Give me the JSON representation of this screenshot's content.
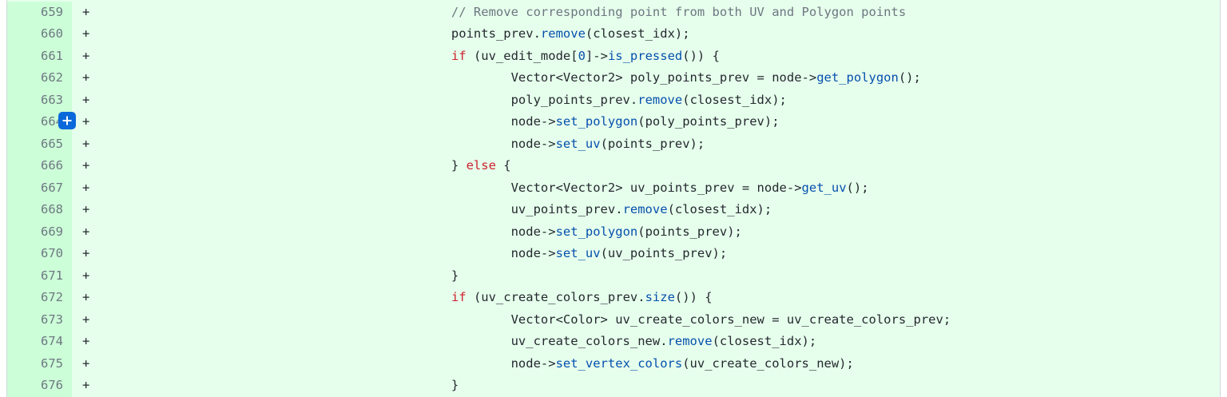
{
  "diff": {
    "marker": "+",
    "add_button_icon": "plus-icon",
    "colors": {
      "added_background": "#e6ffec",
      "added_gutter": "#ccffd8",
      "keyword": "#cf222e",
      "function": "#0550ae",
      "comment": "#6e7781",
      "button": "#0969da"
    },
    "lines": [
      {
        "num": "659",
        "tokens": [
          {
            "t": "cm",
            "s": "                                                // Remove corresponding point from both UV and Polygon points"
          }
        ]
      },
      {
        "num": "660",
        "tokens": [
          {
            "t": "pl",
            "s": "                                                points_prev."
          },
          {
            "t": "fn",
            "s": "remove"
          },
          {
            "t": "pl",
            "s": "(closest_idx);"
          }
        ]
      },
      {
        "num": "661",
        "tokens": [
          {
            "t": "pl",
            "s": "                                                "
          },
          {
            "t": "kw",
            "s": "if"
          },
          {
            "t": "pl",
            "s": " (uv_edit_mode["
          },
          {
            "t": "num",
            "s": "0"
          },
          {
            "t": "pl",
            "s": "]->"
          },
          {
            "t": "fn",
            "s": "is_pressed"
          },
          {
            "t": "pl",
            "s": "()) {"
          }
        ]
      },
      {
        "num": "662",
        "tokens": [
          {
            "t": "pl",
            "s": "                                                        Vector<Vector2> poly_points_prev = node->"
          },
          {
            "t": "fn",
            "s": "get_polygon"
          },
          {
            "t": "pl",
            "s": "();"
          }
        ]
      },
      {
        "num": "663",
        "tokens": [
          {
            "t": "pl",
            "s": "                                                        poly_points_prev."
          },
          {
            "t": "fn",
            "s": "remove"
          },
          {
            "t": "pl",
            "s": "(closest_idx);"
          }
        ]
      },
      {
        "num": "664",
        "tokens": [
          {
            "t": "pl",
            "s": "                                                        node->"
          },
          {
            "t": "fn",
            "s": "set_polygon"
          },
          {
            "t": "pl",
            "s": "(poly_points_prev);"
          }
        ]
      },
      {
        "num": "665",
        "tokens": [
          {
            "t": "pl",
            "s": "                                                        node->"
          },
          {
            "t": "fn",
            "s": "set_uv"
          },
          {
            "t": "pl",
            "s": "(points_prev);"
          }
        ]
      },
      {
        "num": "666",
        "tokens": [
          {
            "t": "pl",
            "s": "                                                } "
          },
          {
            "t": "kw",
            "s": "else"
          },
          {
            "t": "pl",
            "s": " {"
          }
        ]
      },
      {
        "num": "667",
        "tokens": [
          {
            "t": "pl",
            "s": "                                                        Vector<Vector2> uv_points_prev = node->"
          },
          {
            "t": "fn",
            "s": "get_uv"
          },
          {
            "t": "pl",
            "s": "();"
          }
        ]
      },
      {
        "num": "668",
        "tokens": [
          {
            "t": "pl",
            "s": "                                                        uv_points_prev."
          },
          {
            "t": "fn",
            "s": "remove"
          },
          {
            "t": "pl",
            "s": "(closest_idx);"
          }
        ]
      },
      {
        "num": "669",
        "tokens": [
          {
            "t": "pl",
            "s": "                                                        node->"
          },
          {
            "t": "fn",
            "s": "set_polygon"
          },
          {
            "t": "pl",
            "s": "(points_prev);"
          }
        ]
      },
      {
        "num": "670",
        "tokens": [
          {
            "t": "pl",
            "s": "                                                        node->"
          },
          {
            "t": "fn",
            "s": "set_uv"
          },
          {
            "t": "pl",
            "s": "(uv_points_prev);"
          }
        ]
      },
      {
        "num": "671",
        "tokens": [
          {
            "t": "pl",
            "s": "                                                }"
          }
        ]
      },
      {
        "num": "672",
        "tokens": [
          {
            "t": "pl",
            "s": "                                                "
          },
          {
            "t": "kw",
            "s": "if"
          },
          {
            "t": "pl",
            "s": " (uv_create_colors_prev."
          },
          {
            "t": "fn",
            "s": "size"
          },
          {
            "t": "pl",
            "s": "()) {"
          }
        ]
      },
      {
        "num": "673",
        "tokens": [
          {
            "t": "pl",
            "s": "                                                        Vector<Color> uv_create_colors_new = uv_create_colors_prev;"
          }
        ]
      },
      {
        "num": "674",
        "tokens": [
          {
            "t": "pl",
            "s": "                                                        uv_create_colors_new."
          },
          {
            "t": "fn",
            "s": "remove"
          },
          {
            "t": "pl",
            "s": "(closest_idx);"
          }
        ]
      },
      {
        "num": "675",
        "tokens": [
          {
            "t": "pl",
            "s": "                                                        node->"
          },
          {
            "t": "fn",
            "s": "set_vertex_colors"
          },
          {
            "t": "pl",
            "s": "(uv_create_colors_new);"
          }
        ]
      },
      {
        "num": "676",
        "tokens": [
          {
            "t": "pl",
            "s": "                                                }"
          }
        ]
      }
    ]
  }
}
